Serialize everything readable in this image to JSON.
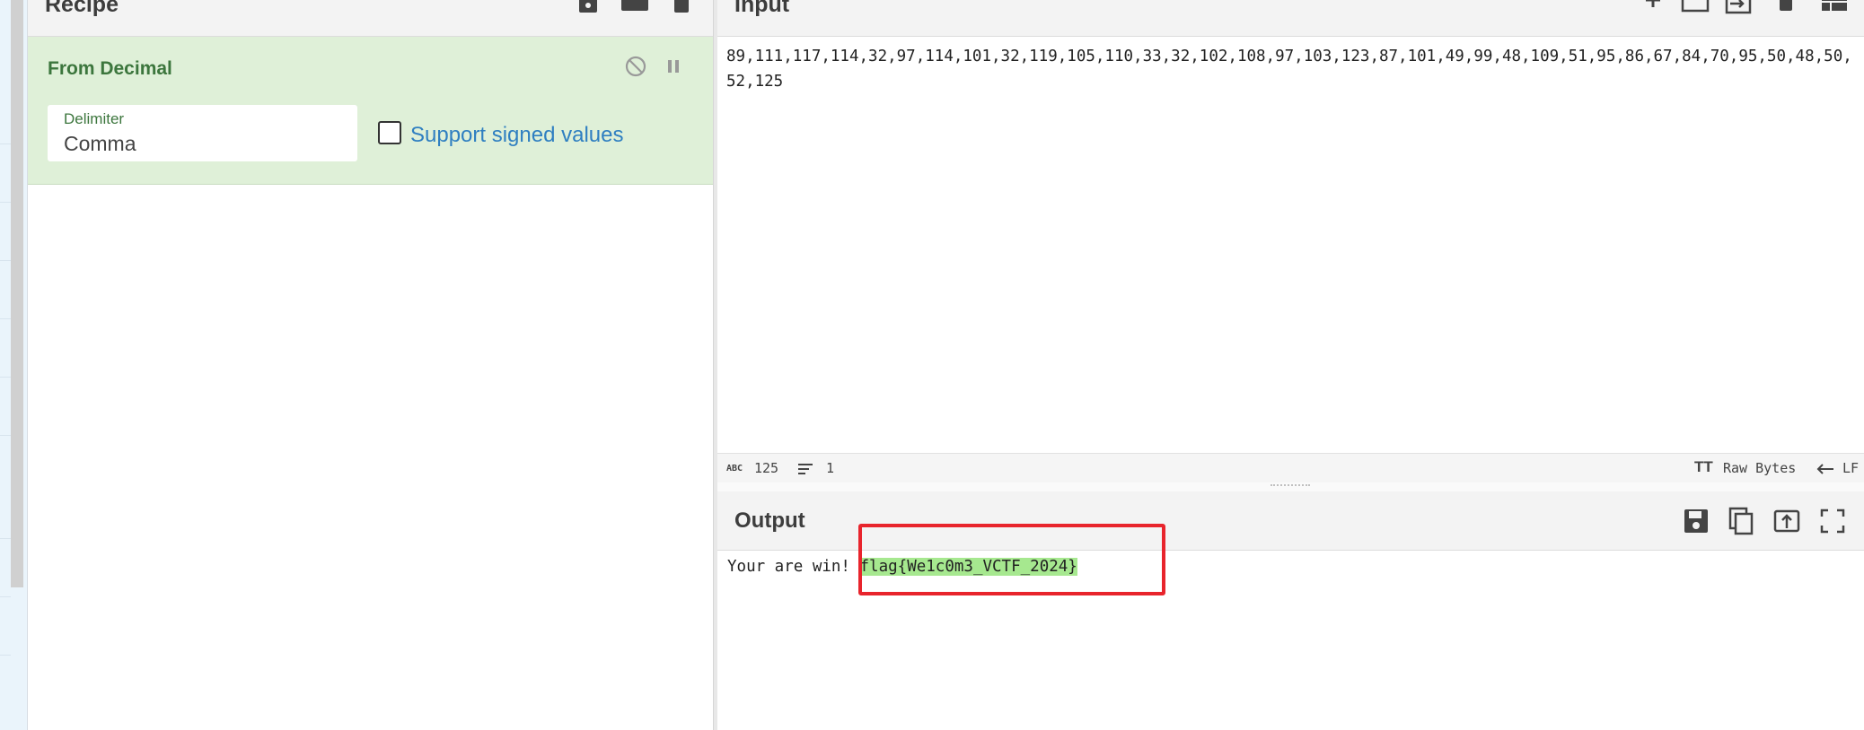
{
  "recipe": {
    "title": "Recipe",
    "operation": {
      "title": "From Decimal",
      "delimiter_label": "Delimiter",
      "delimiter_value": "Comma",
      "signed_label": "Support signed values",
      "signed_checked": false
    }
  },
  "input": {
    "title": "Input",
    "text": "89,111,117,114,32,97,114,101,32,119,105,110,33,32,102,108,97,103,123,87,101,49,99,48,109,51,95,86,67,84,70,95,50,48,50,52,125",
    "status": {
      "chars": "125",
      "lines": "1",
      "encoding": "Raw Bytes",
      "eol": "LF"
    }
  },
  "output": {
    "title": "Output",
    "prefix": "Your are win! ",
    "flag": "flag{We1c0m3_VCTF_2024}"
  },
  "colors": {
    "accent_green": "#3c763d",
    "card_bg": "#dff0d8",
    "highlight": "#a6e88f",
    "annotation_red": "#e8242c",
    "link_blue": "#2f7fc1"
  }
}
